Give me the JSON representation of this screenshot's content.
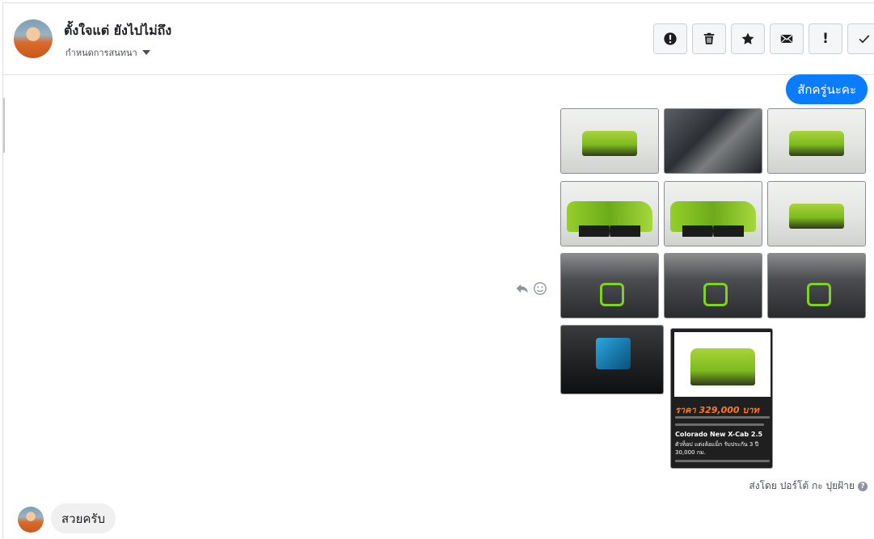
{
  "header": {
    "conversation_name": "ตั้งใจแต่ ยังไปไม่ถึง",
    "conversation_menu_label": "กำหนดการสนทนา",
    "toolbar_buttons": [
      {
        "name": "spam",
        "icon": "exclamation-circle-icon"
      },
      {
        "name": "delete",
        "icon": "trash-icon"
      },
      {
        "name": "star",
        "icon": "star-icon"
      },
      {
        "name": "mark-unread",
        "icon": "envelope-icon"
      },
      {
        "name": "priority",
        "icon": "exclamation-icon"
      },
      {
        "name": "done",
        "icon": "check-icon"
      }
    ]
  },
  "messages": {
    "outgoing_text": "สักครู่นะคะ",
    "photos": [
      {
        "kind": "car-front"
      },
      {
        "kind": "engine"
      },
      {
        "kind": "car-rear"
      },
      {
        "kind": "car-side"
      },
      {
        "kind": "car-side"
      },
      {
        "kind": "car-front-angle"
      },
      {
        "kind": "interior"
      },
      {
        "kind": "interior"
      },
      {
        "kind": "interior"
      },
      {
        "kind": "dashboard"
      }
    ],
    "ad_card": {
      "price": "ราคา 329,000 บาท",
      "model": "Colorado New X-Cab 2.5",
      "desc_line_1": "ตัวท็อป แต่งล้อแม็ก รับประกัน 3 ปี",
      "desc_line_2": "30,000 กม."
    },
    "sent_by": "ส่งโดย ปอร์โต้ กะ ปุยฝ้าย",
    "help_glyph": "?",
    "incoming_text": "สวยครับ"
  },
  "colors": {
    "accent": "#0a7cff",
    "incoming_bubble": "#f0f0f0"
  }
}
